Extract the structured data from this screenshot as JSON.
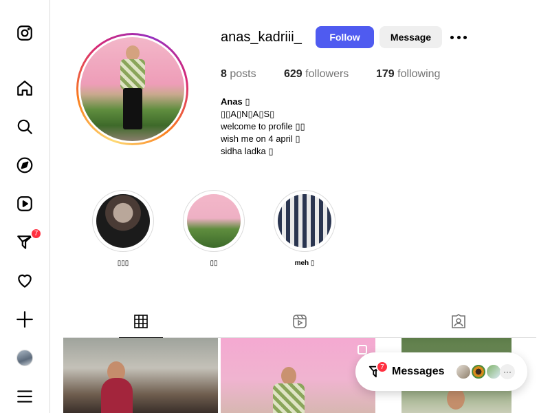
{
  "sidebar": {
    "items": [
      {
        "name": "instagram-logo-icon"
      },
      {
        "name": "home-icon"
      },
      {
        "name": "search-icon"
      },
      {
        "name": "explore-icon"
      },
      {
        "name": "reels-icon"
      },
      {
        "name": "messages-icon",
        "badge": "7"
      },
      {
        "name": "notifications-heart-icon"
      },
      {
        "name": "create-plus-icon"
      },
      {
        "name": "profile-avatar"
      },
      {
        "name": "more-menu-icon"
      }
    ]
  },
  "profile": {
    "username": "anas_kadriii_",
    "follow_label": "Follow",
    "message_label": "Message",
    "stats": {
      "posts_count": "8",
      "posts_label": "posts",
      "followers_count": "629",
      "followers_label": "followers",
      "following_count": "179",
      "following_label": "following"
    },
    "bio": {
      "name": "Anas ▯",
      "lines": [
        "▯▯A▯N▯A▯S▯",
        "welcome to profile ▯▯",
        "wish me on 4 april ▯",
        "sidha ladka ▯"
      ]
    }
  },
  "highlights": [
    {
      "label": "▯▯▯"
    },
    {
      "label": "▯▯"
    },
    {
      "label": "meh ▯"
    }
  ],
  "tabs": [
    {
      "name": "posts-grid-icon",
      "active": true
    },
    {
      "name": "reels-tab-icon",
      "active": false
    },
    {
      "name": "tagged-icon",
      "active": false
    }
  ],
  "messages_pill": {
    "label": "Messages",
    "badge": "7",
    "more": "···"
  },
  "colors": {
    "follow_button": "#4f5bf0",
    "badge": "#ff3040",
    "secondary_text": "#737373"
  }
}
